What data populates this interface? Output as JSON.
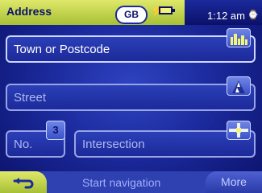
{
  "header": {
    "title": "Address",
    "country": "GB",
    "time": "1:12 am",
    "icons": [
      "bolt-icon",
      "battery-icon",
      "clock-icon"
    ]
  },
  "fields": {
    "town": "Town or Postcode",
    "street": "Street",
    "number": "No.",
    "intersection": "Intersection"
  },
  "icons": {
    "town": "city-skyline-icon",
    "street": "street-road-icon",
    "number": "number-3-icon",
    "intersection": "intersection-icon"
  },
  "footer": {
    "back": "back-arrow-icon",
    "start": "Start navigation",
    "more": "More"
  },
  "colors": {
    "top_accent": "#c9d94a",
    "background_blue": "#1b2a9c",
    "border_light": "#cfd6ff"
  }
}
